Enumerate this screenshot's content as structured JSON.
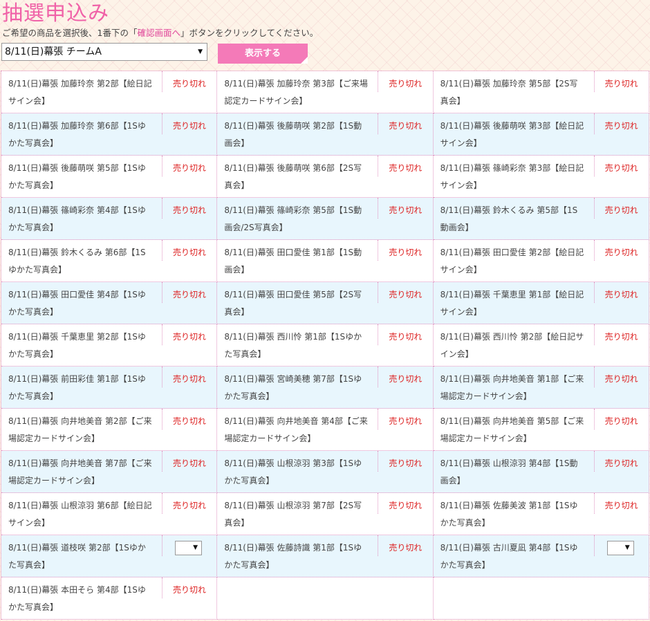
{
  "header": {
    "title": "抽選申込み",
    "instruction_pre": "ご希望の商品を選択後、1番下の「",
    "instruction_link": "確認画面へ",
    "instruction_post": "」ボタンをクリックしてください。"
  },
  "event_select": {
    "value": "8/11(日)幕張 チームA",
    "arrow": "▼"
  },
  "show_button": {
    "label": "表示する"
  },
  "items": [
    {
      "name": "8/11(日)幕張 加藤玲奈 第2部【絵日記サイン会】",
      "status": "売り切れ"
    },
    {
      "name": "8/11(日)幕張 加藤玲奈 第3部【ご来場認定カードサイン会】",
      "status": "売り切れ"
    },
    {
      "name": "8/11(日)幕張 加藤玲奈 第5部【2S写真会】",
      "status": "売り切れ"
    },
    {
      "name": "8/11(日)幕張 加藤玲奈 第6部【1Sゆかた写真会】",
      "status": "売り切れ"
    },
    {
      "name": "8/11(日)幕張 後藤萌咲 第2部【1S動画会】",
      "status": "売り切れ"
    },
    {
      "name": "8/11(日)幕張 後藤萌咲 第3部【絵日記サイン会】",
      "status": "売り切れ"
    },
    {
      "name": "8/11(日)幕張 後藤萌咲 第5部【1Sゆかた写真会】",
      "status": "売り切れ"
    },
    {
      "name": "8/11(日)幕張 後藤萌咲 第6部【2S写真会】",
      "status": "売り切れ"
    },
    {
      "name": "8/11(日)幕張 篠崎彩奈 第3部【絵日記サイン会】",
      "status": "売り切れ"
    },
    {
      "name": "8/11(日)幕張 篠崎彩奈 第4部【1Sゆかた写真会】",
      "status": "売り切れ"
    },
    {
      "name": "8/11(日)幕張 篠崎彩奈 第5部【1S動画会/2S写真会】",
      "status": "売り切れ"
    },
    {
      "name": "8/11(日)幕張 鈴木くるみ 第5部【1S動画会】",
      "status": "売り切れ"
    },
    {
      "name": "8/11(日)幕張 鈴木くるみ 第6部【1Sゆかた写真会】",
      "status": "売り切れ"
    },
    {
      "name": "8/11(日)幕張 田口愛佳 第1部【1S動画会】",
      "status": "売り切れ"
    },
    {
      "name": "8/11(日)幕張 田口愛佳 第2部【絵日記サイン会】",
      "status": "売り切れ"
    },
    {
      "name": "8/11(日)幕張 田口愛佳 第4部【1Sゆかた写真会】",
      "status": "売り切れ"
    },
    {
      "name": "8/11(日)幕張 田口愛佳 第5部【2S写真会】",
      "status": "売り切れ"
    },
    {
      "name": "8/11(日)幕張 千葉恵里 第1部【絵日記サイン会】",
      "status": "売り切れ"
    },
    {
      "name": "8/11(日)幕張 千葉恵里 第2部【1Sゆかた写真会】",
      "status": "売り切れ"
    },
    {
      "name": "8/11(日)幕張 西川怜 第1部【1Sゆかた写真会】",
      "status": "売り切れ"
    },
    {
      "name": "8/11(日)幕張 西川怜 第2部【絵日記サイン会】",
      "status": "売り切れ"
    },
    {
      "name": "8/11(日)幕張 前田彩佳 第1部【1Sゆかた写真会】",
      "status": "売り切れ"
    },
    {
      "name": "8/11(日)幕張 宮崎美穂 第7部【1Sゆかた写真会】",
      "status": "売り切れ"
    },
    {
      "name": "8/11(日)幕張 向井地美音 第1部【ご来場認定カードサイン会】",
      "status": "売り切れ"
    },
    {
      "name": "8/11(日)幕張 向井地美音 第2部【ご来場認定カードサイン会】",
      "status": "売り切れ"
    },
    {
      "name": "8/11(日)幕張 向井地美音 第4部【ご来場認定カードサイン会】",
      "status": "売り切れ"
    },
    {
      "name": "8/11(日)幕張 向井地美音 第5部【ご来場認定カードサイン会】",
      "status": "売り切れ"
    },
    {
      "name": "8/11(日)幕張 向井地美音 第7部【ご来場認定カードサイン会】",
      "status": "売り切れ"
    },
    {
      "name": "8/11(日)幕張 山根涼羽 第3部【1Sゆかた写真会】",
      "status": "売り切れ"
    },
    {
      "name": "8/11(日)幕張 山根涼羽 第4部【1S動画会】",
      "status": "売り切れ"
    },
    {
      "name": "8/11(日)幕張 山根涼羽 第6部【絵日記サイン会】",
      "status": "売り切れ"
    },
    {
      "name": "8/11(日)幕張 山根涼羽 第7部【2S写真会】",
      "status": "売り切れ"
    },
    {
      "name": "8/11(日)幕張 佐藤美波 第1部【1Sゆかた写真会】",
      "status": "売り切れ"
    },
    {
      "name": "8/11(日)幕張 道枝咲 第2部【1Sゆかた写真会】",
      "status": "",
      "select": "▼"
    },
    {
      "name": "8/11(日)幕張 佐藤詩識 第1部【1Sゆかた写真会】",
      "status": "売り切れ"
    },
    {
      "name": "8/11(日)幕張 古川夏凪 第4部【1Sゆかた写真会】",
      "status": "",
      "select": "▼"
    },
    {
      "name": "8/11(日)幕張 本田そら 第4部【1Sゆかた写真会】",
      "status": "売り切れ"
    }
  ],
  "colors": {
    "accent": "#f062a8",
    "button": "#f47ab8",
    "soldout": "#dd2222",
    "row_alt": "#e8f6fd"
  }
}
